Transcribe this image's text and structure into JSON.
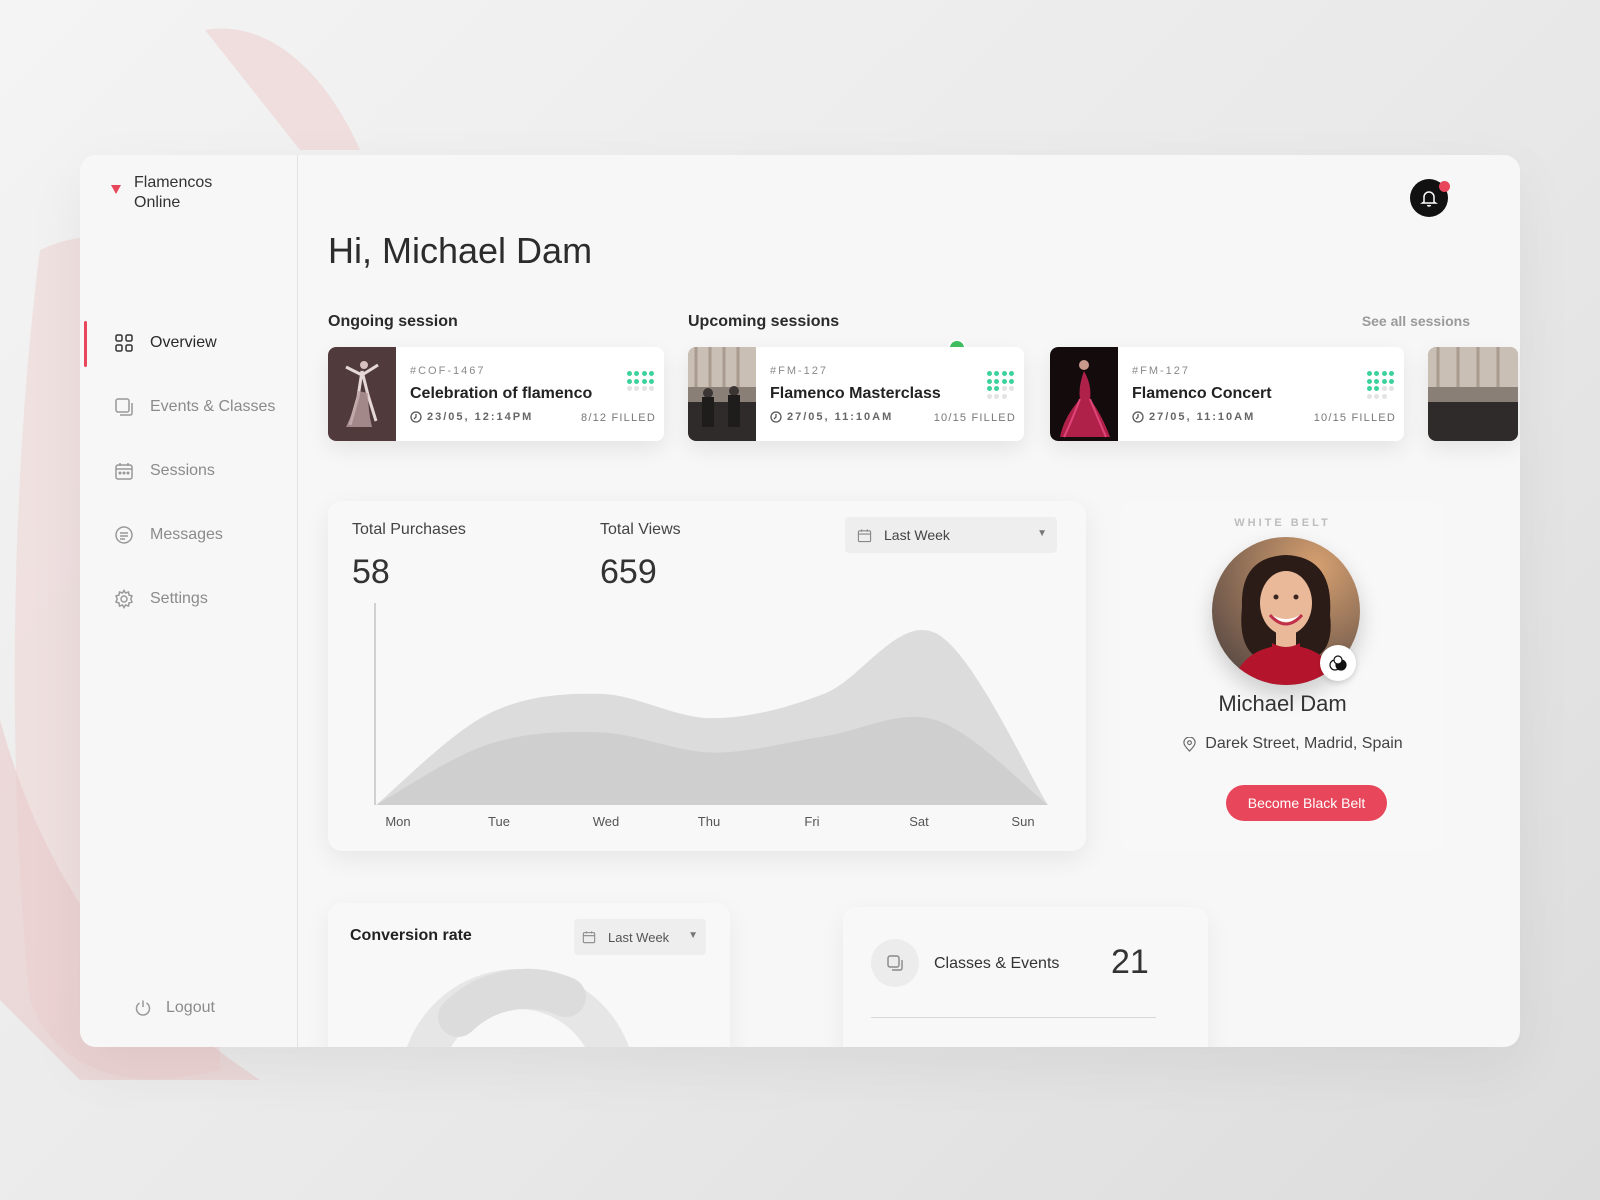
{
  "app": {
    "brand_name": "Flamencos Online",
    "accent_color": "#e8465a"
  },
  "sidebar": {
    "items": [
      {
        "label": "Overview",
        "icon": "grid-icon",
        "active": true
      },
      {
        "label": "Events & Classes",
        "icon": "layers-icon",
        "active": false
      },
      {
        "label": "Sessions",
        "icon": "calendar-icon",
        "active": false
      },
      {
        "label": "Messages",
        "icon": "message-icon",
        "active": false
      },
      {
        "label": "Settings",
        "icon": "gear-icon",
        "active": false
      }
    ],
    "logout_label": "Logout"
  },
  "header": {
    "greeting": "Hi, Michael Dam",
    "notification_icon": "bell-icon"
  },
  "sessions": {
    "ongoing_label": "Ongoing session",
    "upcoming_label": "Upcoming sessions",
    "see_all_label": "See all sessions",
    "ongoing": {
      "code": "#COF-1467",
      "title": "Celebration of flamenco",
      "time": "23/05, 12:14PM",
      "filled": "8/12 FILLED",
      "filled_count": 8,
      "capacity": 12
    },
    "upcoming": [
      {
        "code": "#FM-127",
        "title": "Flamenco Masterclass",
        "time": "27/05, 11:10AM",
        "filled": "10/15 FILLED",
        "filled_count": 10,
        "capacity": 15
      },
      {
        "code": "#FM-127",
        "title": "Flamenco Concert",
        "time": "27/05, 11:10AM",
        "filled": "10/15 FILLED",
        "filled_count": 10,
        "capacity": 15
      }
    ]
  },
  "stats": {
    "purchases_label": "Total Purchases",
    "purchases_value": "58",
    "views_label": "Total Views",
    "views_value": "659",
    "period": "Last Week"
  },
  "chart_data": {
    "type": "area",
    "categories": [
      "Mon",
      "Tue",
      "Wed",
      "Thu",
      "Fri",
      "Sat",
      "Sun"
    ],
    "series": [
      {
        "values": [
          0,
          45,
          55,
          43,
          55,
          85,
          0
        ]
      },
      {
        "values": [
          0,
          30,
          36,
          26,
          34,
          42,
          0
        ]
      }
    ],
    "ylim": [
      0,
      100
    ],
    "grid": false
  },
  "profile": {
    "belt": "WHITE BELT",
    "name": "Michael Dam",
    "location": "Darek Street, Madrid, Spain",
    "cta_label": "Become Black Belt"
  },
  "conversion": {
    "title": "Conversion rate",
    "period": "Last Week"
  },
  "classes": {
    "label": "Classes & Events",
    "value": "21"
  }
}
